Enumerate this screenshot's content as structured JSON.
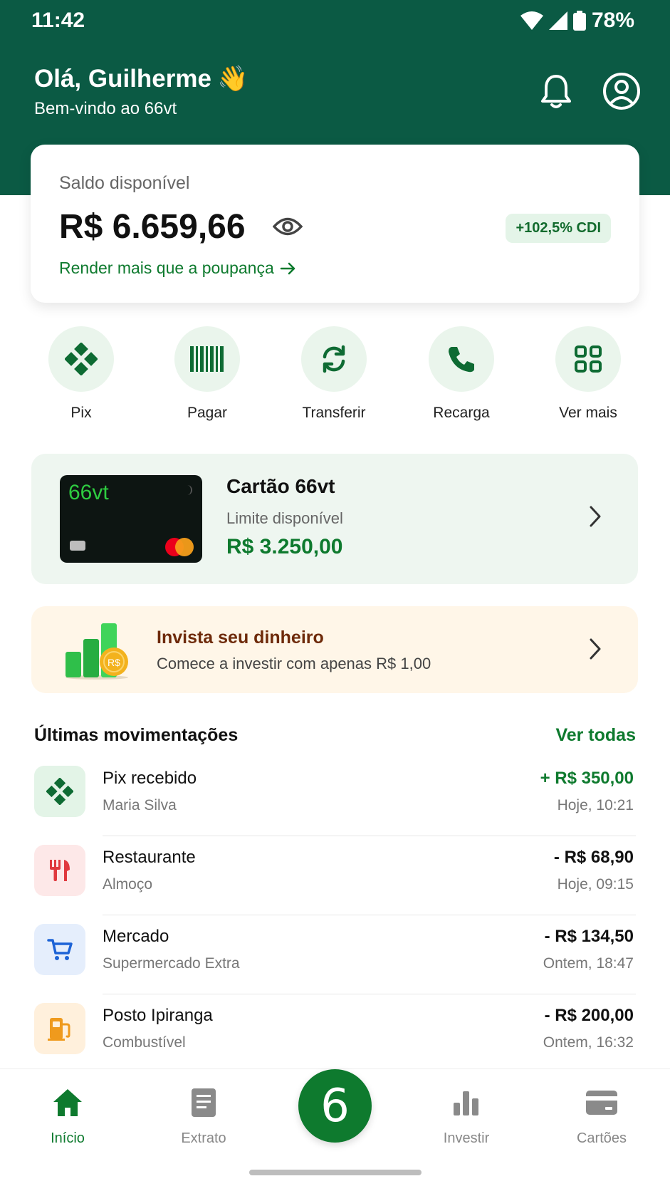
{
  "status": {
    "time": "11:42",
    "battery": "78%"
  },
  "header": {
    "greeting": "Olá, Guilherme",
    "wave_emoji": "👋",
    "subtitle": "Bem-vindo ao 66vt",
    "icons": [
      "bell-icon",
      "user-icon"
    ]
  },
  "balance": {
    "label": "Saldo disponível",
    "value": "R$ 6.659,66",
    "badge": "+102,5% CDI",
    "link": "Render mais que a poupança"
  },
  "actions": [
    {
      "label": "Pix",
      "icon": "pix-icon"
    },
    {
      "label": "Pagar",
      "icon": "barcode-icon"
    },
    {
      "label": "Transferir",
      "icon": "transfer-icon"
    },
    {
      "label": "Recarga",
      "icon": "phone-icon"
    },
    {
      "label": "Ver mais",
      "icon": "grid-icon"
    }
  ],
  "card": {
    "brand": "66vt",
    "title": "Cartão 66vt",
    "subtitle": "Limite disponível",
    "value": "R$ 3.250,00"
  },
  "invest": {
    "title": "Invista seu dinheiro",
    "subtitle": "Comece a investir com apenas R$ 1,00",
    "coin_label": "R$"
  },
  "transactions_section": {
    "title": "Últimas movimentações",
    "link": "Ver todas"
  },
  "transactions": [
    {
      "title": "Pix recebido",
      "subtitle": "Maria Silva",
      "amount": "+ R$ 350,00",
      "date": "Hoje, 10:21",
      "icon": "pix-icon",
      "color": "#e3f4e7"
    },
    {
      "title": "Restaurante",
      "subtitle": "Almoço",
      "amount": "- R$ 68,90",
      "date": "Hoje, 09:15",
      "icon": "cutlery-icon",
      "color": "#fde8e8"
    },
    {
      "title": "Mercado",
      "subtitle": "Supermercado Extra",
      "amount": "- R$ 134,50",
      "date": "Ontem, 18:47",
      "icon": "cart-icon",
      "color": "#e5eefc"
    },
    {
      "title": "Posto Ipiranga",
      "subtitle": "Combustível",
      "amount": "- R$ 200,00",
      "date": "Ontem, 16:32",
      "icon": "fuel-icon",
      "color": "#fff0dc"
    }
  ],
  "nav": {
    "items": [
      {
        "label": "Início",
        "icon": "home-icon",
        "active": true
      },
      {
        "label": "Extrato",
        "icon": "document-icon",
        "active": false
      },
      {
        "label": "Investir",
        "icon": "bar-chart-icon",
        "active": false
      },
      {
        "label": "Cartões",
        "icon": "credit-card-icon",
        "active": false
      }
    ],
    "fab_label": "6"
  },
  "colors": {
    "primary": "#0b5a44",
    "accent": "#0e7a2e",
    "badge_bg": "#e4f4e8"
  }
}
